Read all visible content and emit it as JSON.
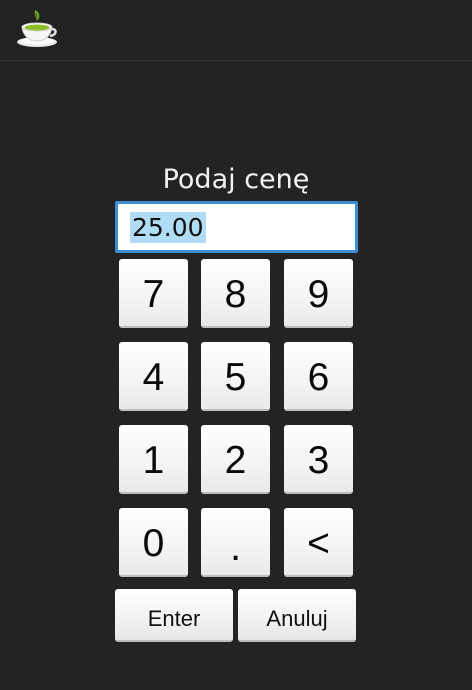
{
  "app": {
    "icon": "green-tea-cup-icon"
  },
  "dialog": {
    "prompt": "Podaj cenę",
    "price_value": "25.00"
  },
  "keypad": {
    "keys": [
      "7",
      "8",
      "9",
      "4",
      "5",
      "6",
      "1",
      "2",
      "3",
      "0",
      ".",
      "<"
    ],
    "enter_label": "Enter",
    "cancel_label": "Anuluj"
  },
  "colors": {
    "background": "#232323",
    "input_border": "#3f8fd8",
    "selection_highlight": "#b0dcf6",
    "key_face": "#f4f4f4"
  }
}
